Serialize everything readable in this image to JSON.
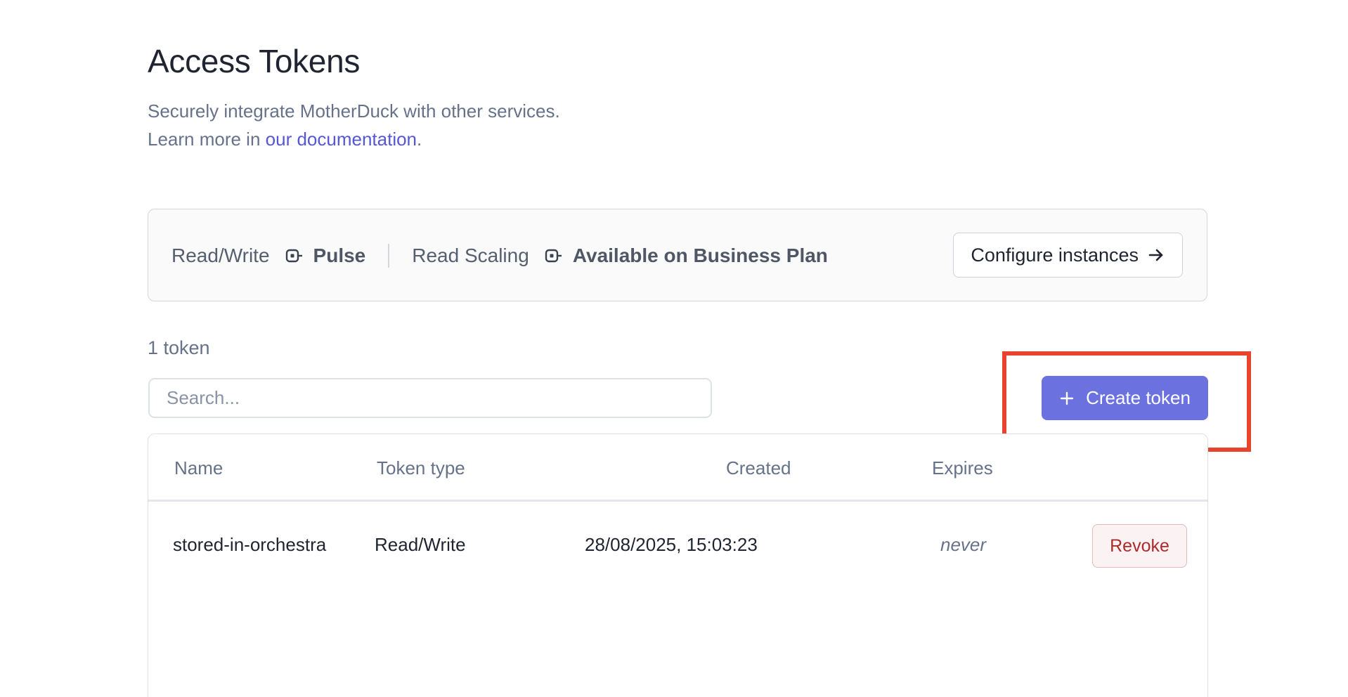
{
  "header": {
    "title": "Access Tokens",
    "subtitle_line1": "Securely integrate MotherDuck with other services.",
    "subtitle_line2_prefix": "Learn more in ",
    "doc_link": "our documentation",
    "subtitle_line2_suffix": "."
  },
  "instances": {
    "read_write_label": "Read/Write",
    "read_write_value": "Pulse",
    "read_scaling_label": "Read Scaling",
    "read_scaling_value": "Available on Business Plan",
    "configure_label": "Configure instances",
    "configure_icon": "arrow-right-icon",
    "instance_icon": "instance-icon"
  },
  "tokens": {
    "count_label": "1 token",
    "search_placeholder": "Search...",
    "create_label": "Create token",
    "create_icon": "plus-icon",
    "columns": {
      "name": "Name",
      "type": "Token type",
      "created": "Created",
      "expires": "Expires"
    },
    "rows": [
      {
        "name": "stored-in-orchestra",
        "type": "Read/Write",
        "created": "28/08/2025, 15:03:23",
        "expires": "never",
        "action": "Revoke"
      }
    ]
  },
  "colors": {
    "accent": "#6b72e0",
    "link": "#5557d6",
    "danger": "#b02a2a",
    "highlight": "#e8432c"
  }
}
